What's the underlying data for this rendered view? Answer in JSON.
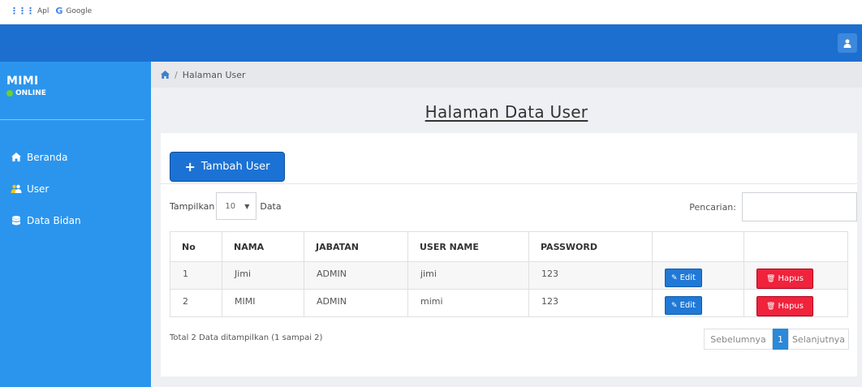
{
  "bookmarks": {
    "apps_label": "Apl",
    "google_label": "Google"
  },
  "sidebar": {
    "profile_name": "MIMI",
    "status": "ONLINE",
    "items": [
      {
        "label": "Beranda",
        "icon": "home-icon"
      },
      {
        "label": "User",
        "icon": "users-icon"
      },
      {
        "label": "Data Bidan",
        "icon": "database-icon"
      }
    ]
  },
  "breadcrumb": {
    "separator": "/",
    "current": "Halaman User"
  },
  "page_title": "Halaman Data User",
  "toolbar": {
    "add_label": "Tambah User",
    "show_label": "Tampilkan",
    "page_length": "10",
    "data_label": "Data",
    "search_label": "Pencarian:",
    "search_value": ""
  },
  "table": {
    "headers": [
      "No",
      "NAMA",
      "JABATAN",
      "USER NAME",
      "PASSWORD",
      "",
      ""
    ],
    "rows": [
      {
        "no": "1",
        "nama": "Jimi",
        "jabatan": "ADMIN",
        "username": "jimi",
        "password": "123",
        "edit": "Edit",
        "hapus": "Hapus"
      },
      {
        "no": "2",
        "nama": "MIMI",
        "jabatan": "ADMIN",
        "username": "mimi",
        "password": "123",
        "edit": "Edit",
        "hapus": "Hapus"
      }
    ]
  },
  "footer": {
    "info": "Total 2 Data ditampilkan (1 sampai 2)",
    "prev_label": "Sebelumnya",
    "current_page": "1",
    "next_label": "Selanjutnya"
  },
  "colors": {
    "topbar": "#1c6fcf",
    "sidebar": "#2b95ee",
    "primary_button": "#1c72d4",
    "danger_button": "#f0223c",
    "online_dot": "#6cd12d"
  }
}
